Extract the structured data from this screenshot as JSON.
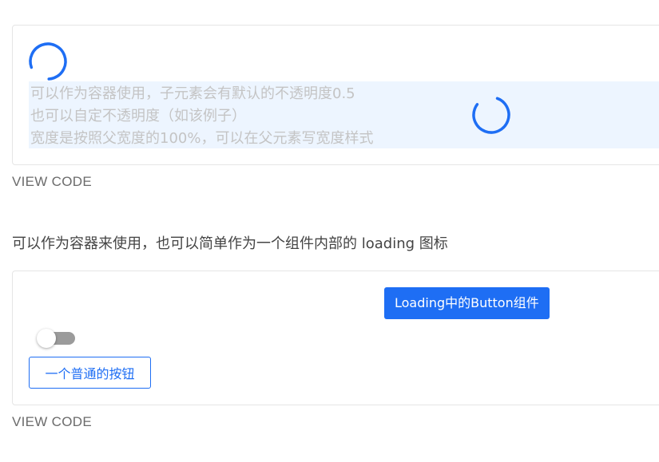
{
  "demo1": {
    "container_text": [
      "可以作为容器使用，子元素会有默认的不透明度0.5",
      "也可以自定不透明度（如该例子）",
      "宽度是按照父宽度的100%，可以在父元素写宽度样式"
    ],
    "view_code": "VIEW CODE"
  },
  "section2": {
    "description": "可以作为容器来使用，也可以简单作为一个组件内部的 loading 图标"
  },
  "demo2": {
    "loading_button_label": "Loading中的Button组件",
    "toggle_on": false,
    "normal_button_label": "一个普通的按钮",
    "view_code": "VIEW CODE"
  },
  "colors": {
    "primary": "#1e6ef4",
    "overlay_background": "#edf5ff",
    "faded_text": "#c4c4c4",
    "toggle_off": "#9b9b9b"
  },
  "icons": {
    "spinner": "loading-spinner-icon"
  }
}
